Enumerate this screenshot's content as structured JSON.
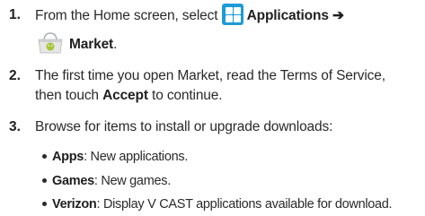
{
  "steps": [
    {
      "number": "1.",
      "lead": "From the Home screen, select",
      "app_label": "Applications",
      "arrow": "➔",
      "market_label": "Market",
      "end": "."
    },
    {
      "number": "2.",
      "line1": "The first time you open Market, read the Terms of Service,",
      "line2_pre": "then touch",
      "line2_bold": "Accept",
      "line2_post": "to continue."
    },
    {
      "number": "3.",
      "text": "Browse for items to install or upgrade downloads:"
    }
  ],
  "bullets": [
    {
      "label": "Apps",
      "desc": ": New applications."
    },
    {
      "label": "Games",
      "desc": ": New games."
    },
    {
      "label": "Verizon",
      "desc": ": Display V CAST applications available for download."
    }
  ],
  "icons": {
    "applications": "applications-grid-icon",
    "market": "market-bag-icon",
    "applications_color": "#1e9bd7",
    "market_color": "#a4c639"
  }
}
